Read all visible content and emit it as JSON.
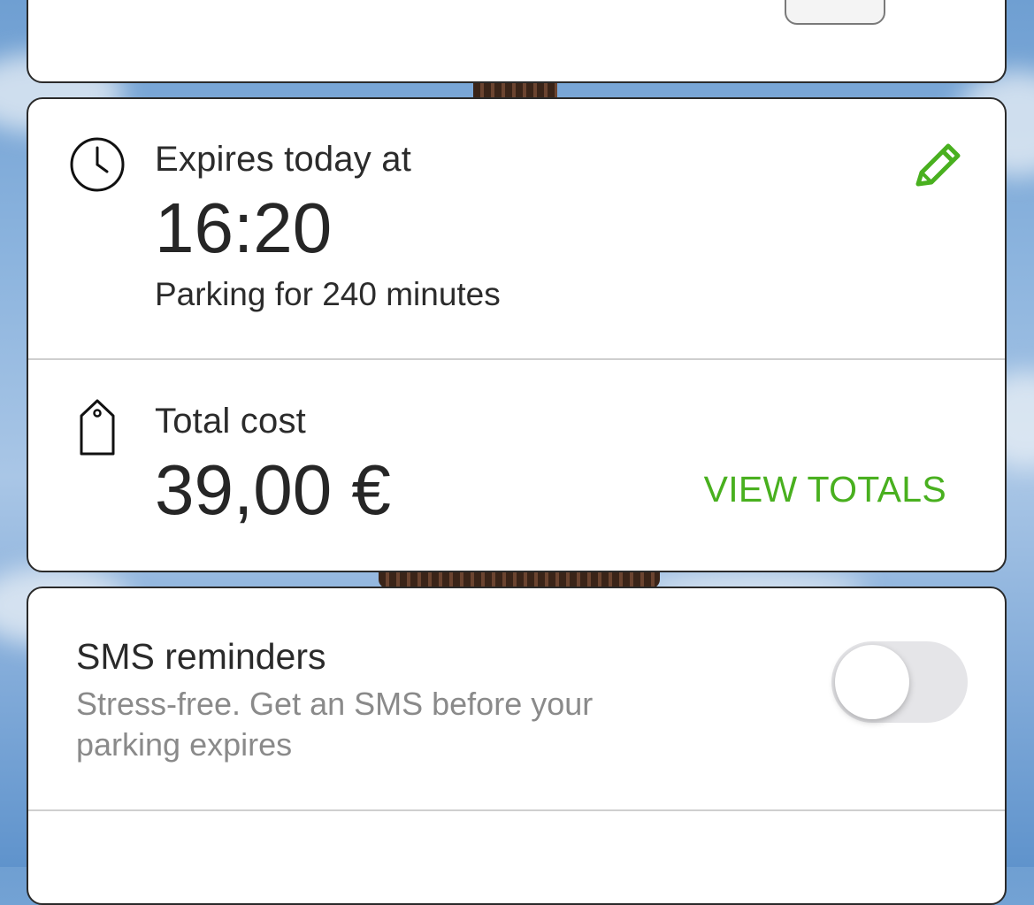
{
  "parking": {
    "expires_label": "Expires today at",
    "expires_time": "16:20",
    "duration_text": "Parking for 240 minutes",
    "cost_label": "Total cost",
    "cost_value": "39,00 €",
    "view_totals_label": "VIEW TOTALS"
  },
  "sms": {
    "title": "SMS reminders",
    "description": "Stress-free. Get an SMS before your parking expires",
    "enabled": false
  },
  "icons": {
    "clock": "clock-icon",
    "edit": "pencil-icon",
    "price": "price-tag-icon"
  },
  "colors": {
    "accent": "#49b01f",
    "text": "#2b2b2b",
    "muted": "#8a8a8a",
    "card": "#ffffff"
  }
}
